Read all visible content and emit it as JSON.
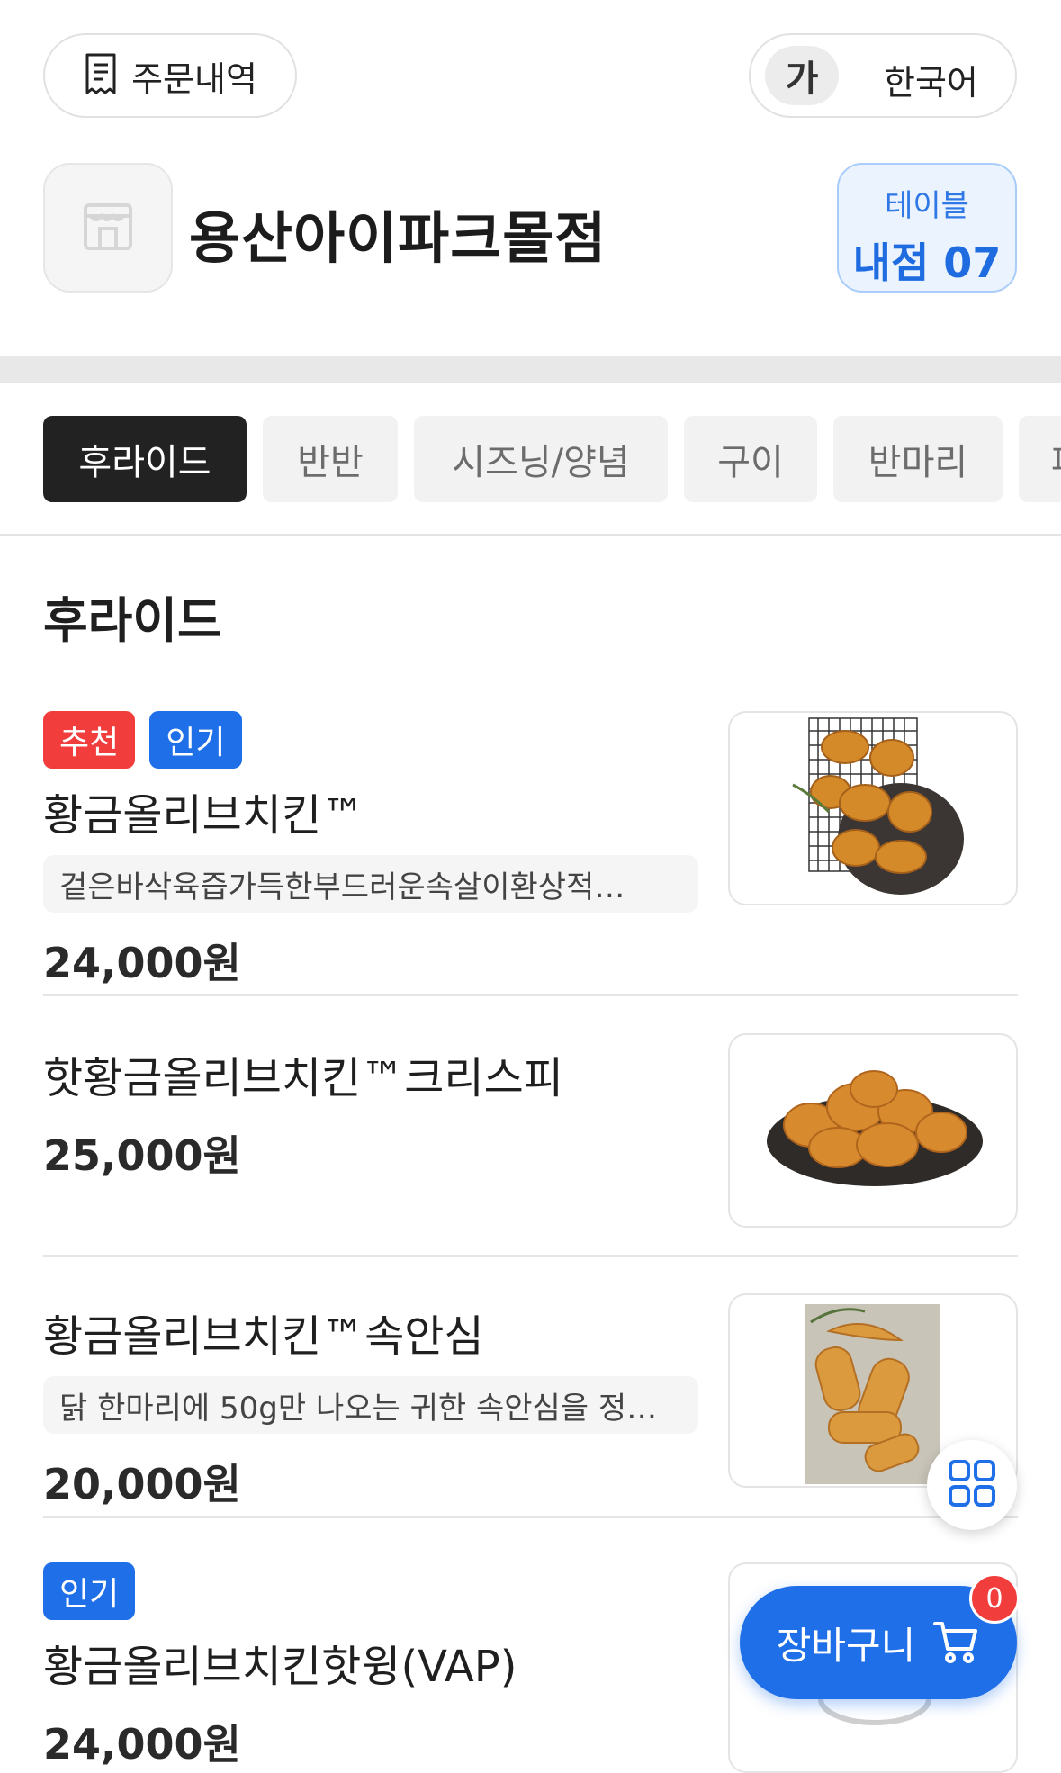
{
  "header": {
    "order_history_label": "주문내역",
    "language_badge": "가",
    "language_label": "한국어"
  },
  "store": {
    "name": "용산아이파크몰점",
    "table_label": "테이블",
    "table_number": "내점 07"
  },
  "tabs": [
    {
      "label": "후라이드",
      "active": true
    },
    {
      "label": "반반",
      "active": false
    },
    {
      "label": "시즈닝/양념",
      "active": false
    },
    {
      "label": "구이",
      "active": false
    },
    {
      "label": "반마리",
      "active": false
    },
    {
      "label": "파",
      "active": false
    }
  ],
  "section": {
    "title": "후라이드"
  },
  "menu": [
    {
      "badges": [
        {
          "text": "추천",
          "color": "#f23d3d"
        },
        {
          "text": "인기",
          "color": "#1f6fe8"
        }
      ],
      "name": "황금올리브치킨™",
      "description": "겉은바삭육즙가득한부드러운속살이환상적…",
      "price": "24,000원",
      "image": "fried-chicken-on-rack"
    },
    {
      "badges": [],
      "name": "핫황금올리브치킨™크리스피",
      "description": "",
      "price": "25,000원",
      "image": "crispy-chicken-plate"
    },
    {
      "badges": [],
      "name": "황금올리브치킨™속안심",
      "description": "닭 한마리에 50g만 나오는 귀한 속안심을 정…",
      "price": "20,000원",
      "image": "chicken-tenders"
    },
    {
      "badges": [
        {
          "text": "인기",
          "color": "#1f6fe8"
        }
      ],
      "name": "황금올리브치킨핫윙(VAP)",
      "description": "",
      "price": "24,000원",
      "image": "hot-wings"
    }
  ],
  "cart": {
    "label": "장바구니",
    "count": "0"
  },
  "colors": {
    "accent": "#1f6fe8",
    "recommend": "#f23d3d",
    "dark_tab": "#222222"
  }
}
